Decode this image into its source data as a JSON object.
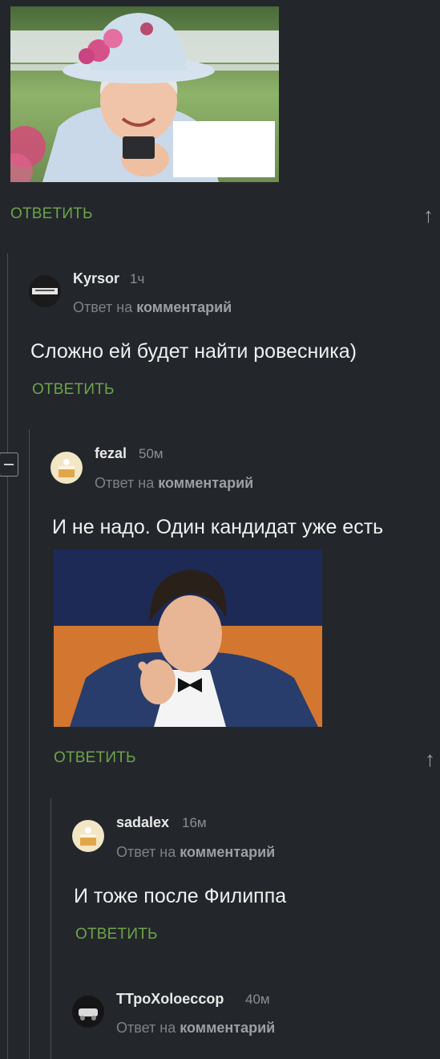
{
  "top_post": {
    "image_alt": "queen-with-phone-photo",
    "reply_label": "ОТВЕТИТЬ",
    "up_arrow": "↑"
  },
  "comments": [
    {
      "username": "Kyrsor",
      "time": "1ч",
      "reply_to_prefix": "Ответ на",
      "reply_to_link": "комментарий",
      "text": "Сложно ей будет найти ровесника)",
      "reply_label": "ОТВЕТИТЬ"
    },
    {
      "username": "fezal",
      "time": "50м",
      "reply_to_prefix": "Ответ на",
      "reply_to_link": "комментарий",
      "text": "И не надо. Один кандидат уже есть",
      "reply_label": "ОТВЕТИТЬ",
      "up_arrow": "↑"
    },
    {
      "username": "sadalex",
      "time": "16м",
      "reply_to_prefix": "Ответ на",
      "reply_to_link": "комментарий",
      "text": "И тоже после Филиппа",
      "reply_label": "ОТВЕТИТЬ"
    },
    {
      "username": "ТТроXoloeccop",
      "time": "40м",
      "reply_to_prefix": "Ответ на",
      "reply_to_link": "комментарий"
    }
  ],
  "colors": {
    "background": "#23272c",
    "reply_green": "#6fa24a",
    "thread_line": "#4a4f55"
  }
}
